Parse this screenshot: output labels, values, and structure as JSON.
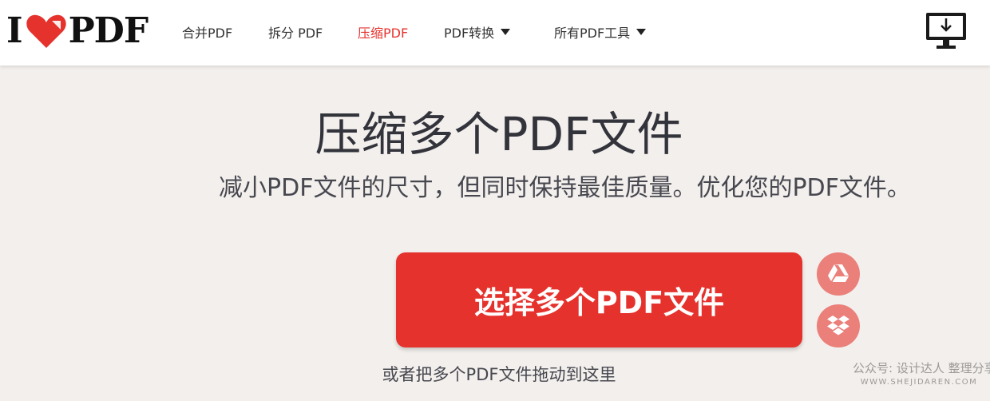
{
  "header": {
    "logo": {
      "prefix": "I",
      "suffix": "PDF",
      "heart_icon": "heart-icon",
      "heart_color": "#e5322d"
    },
    "nav": [
      {
        "label": "合并PDF",
        "active": false,
        "dropdown": false
      },
      {
        "label": "拆分 PDF",
        "active": false,
        "dropdown": false
      },
      {
        "label": "压缩PDF",
        "active": true,
        "dropdown": false
      },
      {
        "label": "PDF转换",
        "active": false,
        "dropdown": true
      },
      {
        "label": "所有PDF工具",
        "active": false,
        "dropdown": true
      }
    ],
    "desktop_icon": "desktop-download-icon"
  },
  "main": {
    "title": "压缩多个PDF文件",
    "subtitle": "减小PDF文件的尺寸，但同时保持最佳质量。优化您的PDF文件。",
    "select_button_label": "选择多个PDF文件",
    "cloud_buttons": [
      {
        "icon": "google-drive-icon"
      },
      {
        "icon": "dropbox-icon"
      }
    ],
    "drop_hint": "或者把多个PDF文件拖动到这里"
  },
  "watermark": {
    "line1": "公众号: 设计达人 整理分享",
    "line2": "WWW.SHEJIDAREN.COM"
  },
  "colors": {
    "accent": "#e5322d",
    "cloud_button": "#eb7f7a",
    "background": "#f2efec",
    "header_bg": "#ffffff"
  }
}
